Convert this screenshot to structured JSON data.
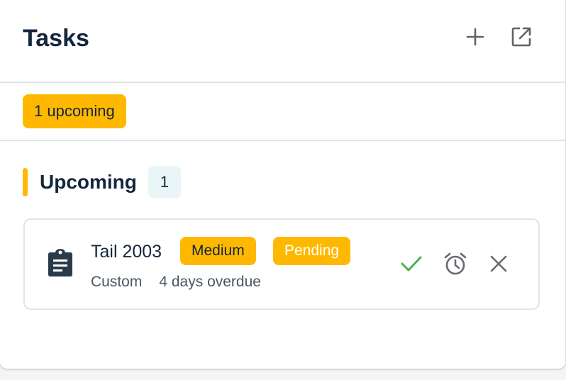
{
  "header": {
    "title": "Tasks",
    "add_icon": "plus-icon",
    "open_icon": "open-in-new-icon"
  },
  "filters": {
    "upcoming_chip": "1 upcoming"
  },
  "section": {
    "title": "Upcoming",
    "count": "1"
  },
  "tasks": [
    {
      "name": "Tail 2003",
      "priority": "Medium",
      "status": "Pending",
      "type": "Custom",
      "due": "4 days overdue",
      "icon": "clipboard-icon",
      "actions": [
        "check-icon",
        "alarm-clock-icon",
        "close-icon"
      ]
    }
  ],
  "colors": {
    "accent": "#ffb800",
    "text_dark": "#13263b",
    "text_muted": "#4a5563",
    "success": "#4caf50",
    "icon_gray": "#666a70",
    "count_bg": "#eaf5f8",
    "divider": "#e2e4e8"
  }
}
